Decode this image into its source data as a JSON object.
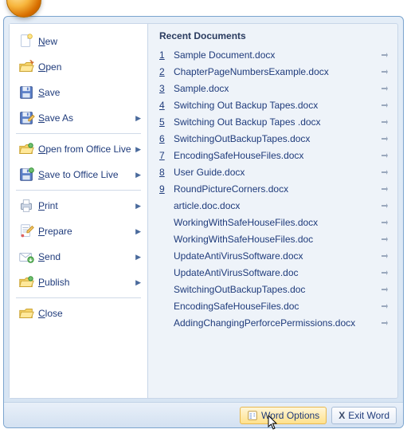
{
  "office_orb": "office-orb",
  "left_menu": {
    "items": [
      {
        "label": "New",
        "icon": "new-doc-icon",
        "has_arrow": false,
        "divider_after": false,
        "name": "menu-item-new"
      },
      {
        "label": "Open",
        "icon": "open-icon",
        "has_arrow": false,
        "divider_after": false,
        "name": "menu-item-open"
      },
      {
        "label": "Save",
        "icon": "save-icon",
        "has_arrow": false,
        "divider_after": false,
        "name": "menu-item-save"
      },
      {
        "label": "Save As",
        "icon": "save-as-icon",
        "has_arrow": true,
        "divider_after": true,
        "name": "menu-item-save-as"
      },
      {
        "label": "Open from Office Live",
        "icon": "open-live-icon",
        "has_arrow": true,
        "divider_after": false,
        "name": "menu-item-open-office-live"
      },
      {
        "label": "Save to Office Live",
        "icon": "save-live-icon",
        "has_arrow": true,
        "divider_after": true,
        "name": "menu-item-save-office-live"
      },
      {
        "label": "Print",
        "icon": "print-icon",
        "has_arrow": true,
        "divider_after": false,
        "name": "menu-item-print"
      },
      {
        "label": "Prepare",
        "icon": "prepare-icon",
        "has_arrow": true,
        "divider_after": false,
        "name": "menu-item-prepare"
      },
      {
        "label": "Send",
        "icon": "send-icon",
        "has_arrow": true,
        "divider_after": false,
        "name": "menu-item-send"
      },
      {
        "label": "Publish",
        "icon": "publish-icon",
        "has_arrow": true,
        "divider_after": true,
        "name": "menu-item-publish"
      },
      {
        "label": "Close",
        "icon": "close-icon",
        "has_arrow": false,
        "divider_after": false,
        "name": "menu-item-close"
      }
    ]
  },
  "recent": {
    "title": "Recent Documents",
    "docs": [
      {
        "num": "1",
        "name": "Sample Document.docx"
      },
      {
        "num": "2",
        "name": "ChapterPageNumbersExample.docx"
      },
      {
        "num": "3",
        "name": "Sample.docx"
      },
      {
        "num": "4",
        "name": "Switching Out Backup Tapes.docx"
      },
      {
        "num": "5",
        "name": "Switching Out Backup Tapes .docx"
      },
      {
        "num": "6",
        "name": "SwitchingOutBackupTapes.docx"
      },
      {
        "num": "7",
        "name": "EncodingSafeHouseFiles.docx"
      },
      {
        "num": "8",
        "name": "User Guide.docx"
      },
      {
        "num": "9",
        "name": "RoundPictureCorners.docx"
      },
      {
        "num": "",
        "name": "article.doc.docx"
      },
      {
        "num": "",
        "name": "WorkingWithSafeHouseFiles.docx"
      },
      {
        "num": "",
        "name": "WorkingWithSafeHouseFiles.doc"
      },
      {
        "num": "",
        "name": "UpdateAntiVirusSoftware.docx"
      },
      {
        "num": "",
        "name": "UpdateAntiVirusSoftware.doc"
      },
      {
        "num": "",
        "name": "SwitchingOutBackupTapes.doc"
      },
      {
        "num": "",
        "name": "EncodingSafeHouseFiles.doc"
      },
      {
        "num": "",
        "name": "AddingChangingPerforcePermissions.docx"
      }
    ]
  },
  "bottom": {
    "word_options": "Word Options",
    "exit_word": "Exit Word"
  },
  "colors": {
    "accent": "#1f3b7b",
    "panel_border": "#7ba4ce"
  }
}
